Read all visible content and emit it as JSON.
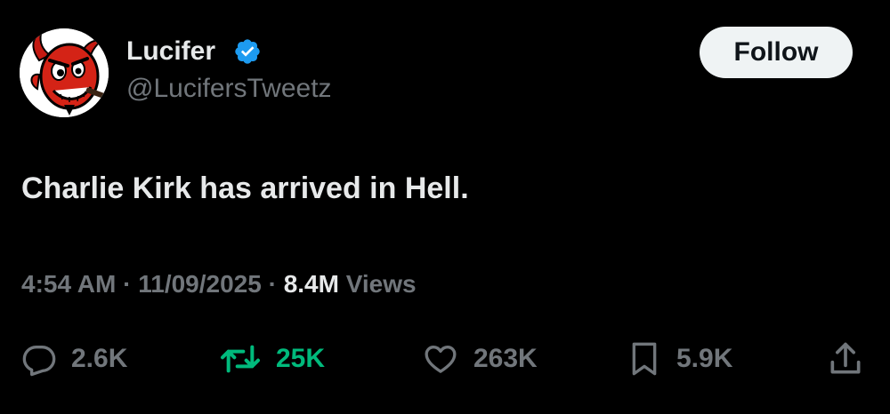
{
  "tweet": {
    "author": {
      "display_name": "Lucifer",
      "handle": "@LucifersTweetz",
      "verified": true,
      "verified_color": "#1d9bf0",
      "avatar_icon": "red-devil-avatar"
    },
    "follow_label": "Follow",
    "text": "Charlie Kirk has arrived in Hell.",
    "time": "4:54 AM",
    "date": "11/09/2025",
    "separator": "·",
    "views_count": "8.4M",
    "views_label": "Views",
    "actions": {
      "replies": "2.6K",
      "reposts": "25K",
      "likes": "263K",
      "bookmarks": "5.9K"
    }
  },
  "theme": {
    "background": "#000000",
    "text_primary": "#e7e9ea",
    "text_secondary": "#71767b",
    "repost_active": "#00ba7c",
    "follow_button_bg": "#eff3f4"
  }
}
